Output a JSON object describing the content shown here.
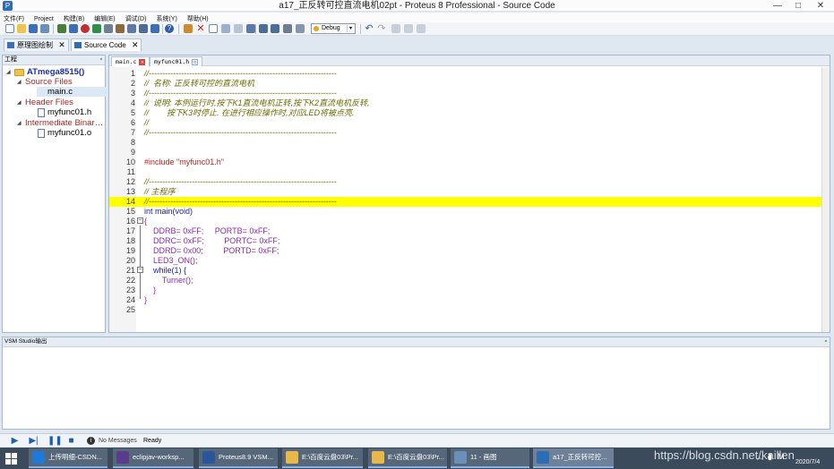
{
  "window": {
    "title": "a17_正反转可控直流电机02pt - Proteus 8 Professional - Source Code",
    "minimize": "—",
    "maximize": "□",
    "close": "✕"
  },
  "menu": [
    "文件(F)",
    "Project",
    "构建(B)",
    "编辑(E)",
    "调试(D)",
    "系统(Y)",
    "帮助(H)"
  ],
  "toolbar": {
    "build_config": "Debug"
  },
  "doc_tabs": [
    {
      "label": "原理图绘制",
      "close": "✕"
    },
    {
      "label": "Source Code",
      "close": "✕"
    }
  ],
  "project_panel": {
    "title": "工程",
    "pin": "▫",
    "root": "ATmega8515()",
    "groups": [
      {
        "label": "Source Files",
        "files": [
          "main.c"
        ]
      },
      {
        "label": "Header Files",
        "files": [
          "myfunc01.h"
        ]
      },
      {
        "label": "Intermediate Binar…",
        "files": [
          "myfunc01.o"
        ]
      }
    ]
  },
  "editor_tabs": [
    {
      "label": "main.c",
      "close": "✕"
    },
    {
      "label": "myfunc01.h",
      "close": "▫"
    }
  ],
  "code": [
    {
      "n": "1",
      "t": "//----------------------------------------------------------------------",
      "k": "comment"
    },
    {
      "n": "2",
      "t": "//  名称: 正反转可控的直流电机",
      "k": "comment"
    },
    {
      "n": "3",
      "t": "//----------------------------------------------------------------------",
      "k": "comment"
    },
    {
      "n": "4",
      "t": "//  说明: 本例运行时,按下K1直流电机正转,按下K2直流电机反转,",
      "k": "comment"
    },
    {
      "n": "5",
      "t": "//        按下K3时停止. 在进行相应操作时,对应LED将被点亮.",
      "k": "comment"
    },
    {
      "n": "6",
      "t": "//",
      "k": "comment"
    },
    {
      "n": "7",
      "t": "//----------------------------------------------------------------------",
      "k": "comment"
    },
    {
      "n": "8",
      "t": "",
      "k": "plain"
    },
    {
      "n": "9",
      "t": "",
      "k": "plain"
    },
    {
      "n": "10",
      "t": "#include \"myfunc01.h\"",
      "k": "pre"
    },
    {
      "n": "11",
      "t": "",
      "k": "plain"
    },
    {
      "n": "12",
      "t": "//----------------------------------------------------------------------",
      "k": "comment"
    },
    {
      "n": "13",
      "t": "// 主程序",
      "k": "comment"
    },
    {
      "n": "14",
      "t": "//----------------------------------------------------------------------",
      "k": "comment"
    },
    {
      "n": "15",
      "t": "int main(void)",
      "k": "kw"
    },
    {
      "n": "16",
      "t": "{",
      "k": "brace"
    },
    {
      "n": "17",
      "t": "    DDRB= 0xFF;     PORTB= 0xFF;",
      "k": "reg"
    },
    {
      "n": "18",
      "t": "    DDRC= 0xFF;         PORTC= 0xFF;",
      "k": "reg"
    },
    {
      "n": "19",
      "t": "    DDRD= 0x00;         PORTD= 0xFF;",
      "k": "reg"
    },
    {
      "n": "20",
      "t": "    LED3_ON();",
      "k": "reg"
    },
    {
      "n": "21",
      "t": "    while(1) {",
      "k": "kw"
    },
    {
      "n": "22",
      "t": "        Turner();",
      "k": "reg"
    },
    {
      "n": "23",
      "t": "    }",
      "k": "brace"
    },
    {
      "n": "24",
      "t": "}",
      "k": "brace"
    },
    {
      "n": "25",
      "t": "",
      "k": "plain"
    }
  ],
  "highlight_line": "14",
  "output_panel": {
    "title": "VSM Studio输出",
    "pin": "▫"
  },
  "sim_bar": {
    "messages": "No Messages",
    "status": "Ready"
  },
  "taskbar": {
    "items": [
      {
        "label": "上传明细-CSDN...",
        "color": "#1f79d6"
      },
      {
        "label": "eclipjav-worksp...",
        "color": "#5b3b8c"
      },
      {
        "label": "Proteus8.9 VSM...",
        "color": "#2b579a"
      },
      {
        "label": "E:\\百度云盘03\\Pr...",
        "color": "#e8b84a"
      },
      {
        "label": "E:\\百度云盘03\\Pr...",
        "color": "#e8b84a"
      },
      {
        "label": "11 - 画图",
        "color": "#6a8fb8"
      },
      {
        "label": "a17_正反转可控...",
        "color": "#2c6db6"
      }
    ],
    "watermark": "https://blog.csdn.net/kaillen",
    "date": "2020/7/4"
  }
}
